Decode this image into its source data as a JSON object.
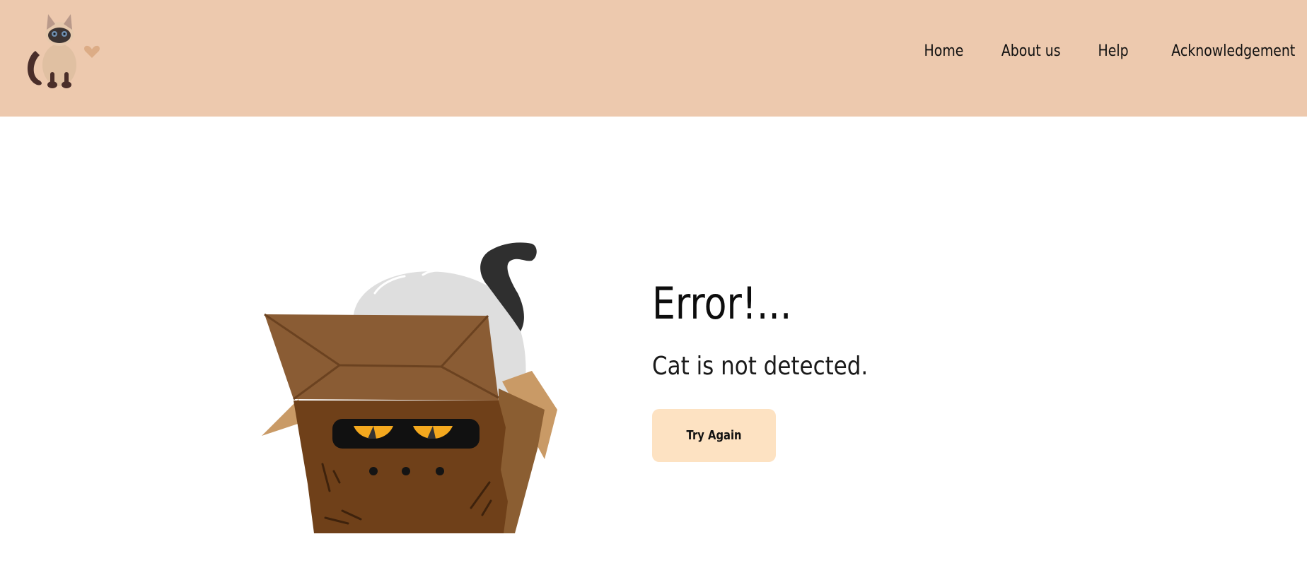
{
  "header": {
    "bg_color": "#edc9ae",
    "logo_icon": "siamese-cat-logo-icon",
    "nav": [
      {
        "label": "Home"
      },
      {
        "label": "About us"
      },
      {
        "label": "Help"
      },
      {
        "label": "Acknowledgement"
      }
    ]
  },
  "main": {
    "illustration_icon": "cat-in-box-icon",
    "title": "Error!...",
    "subtitle": "Cat is not detected.",
    "button_label": "Try Again",
    "button_color": "#fde2c2"
  }
}
